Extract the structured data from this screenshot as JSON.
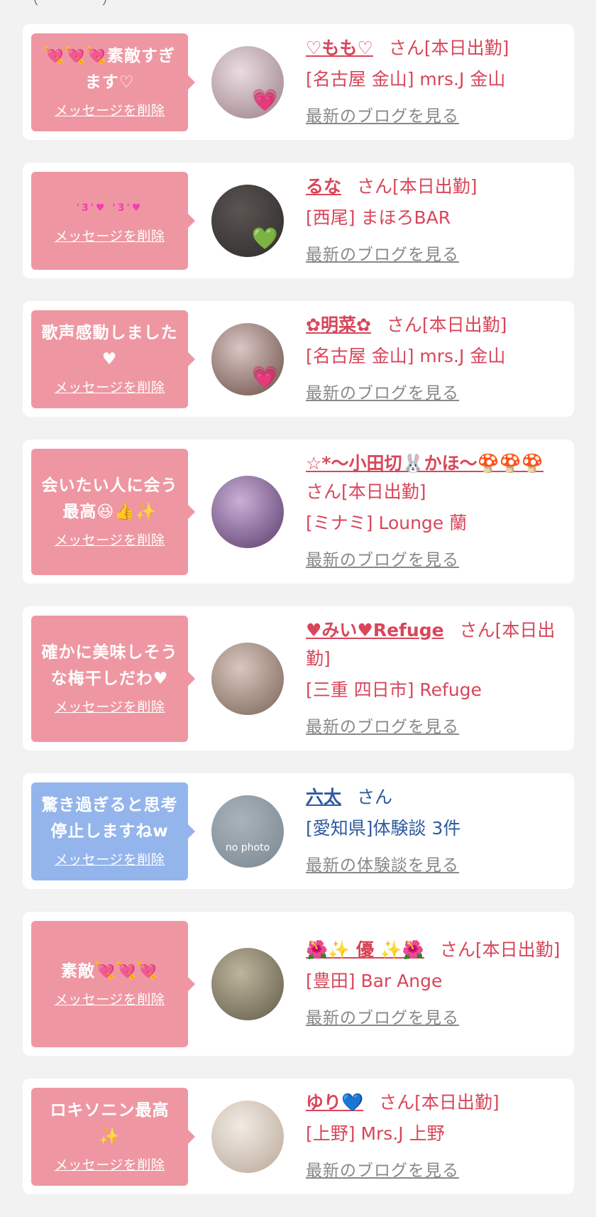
{
  "page": {
    "top_fragment": "（　　　　　）",
    "cards": [
      {
        "message": "💘💘💘素敵すぎます♡",
        "delete_label": "メッセージを削除",
        "name": "♡もも♡",
        "suffix": "さん[本日出勤]",
        "shop": "[名古屋 金山] mrs.J 金山",
        "link": "最新のブログを見る",
        "avatar_colors": [
          "#e9dde2",
          "#9a7e84"
        ],
        "avatar_emoji": "💗",
        "theme": "pink"
      },
      {
        "message": "'3'♥ '3'♥",
        "delete_label": "メッセージを削除",
        "name": "るな",
        "suffix": "さん[本日出勤]",
        "shop": "[西尾] まほろBAR",
        "link": "最新のブログを見る",
        "avatar_colors": [
          "#5b5552",
          "#2e2b2a"
        ],
        "avatar_emoji": "💚",
        "theme": "pink"
      },
      {
        "message": "歌声感動しました♥",
        "delete_label": "メッセージを削除",
        "name": "✿明菜✿",
        "suffix": "さん[本日出勤]",
        "shop": "[名古屋 金山] mrs.J 金山",
        "link": "最新のブログを見る",
        "avatar_colors": [
          "#d9c6c4",
          "#6a4d44"
        ],
        "avatar_emoji": "💗",
        "theme": "pink"
      },
      {
        "message": "会いたい人に会う最高😆👍✨",
        "delete_label": "メッセージを削除",
        "name": "☆*〜小田切🐰かほ〜🍄🍄🍄",
        "suffix": "さん[本日出勤]",
        "shop": "[ミナミ] Lounge 蘭",
        "link": "最新のブログを見る",
        "avatar_colors": [
          "#c9b0d6",
          "#5a3a6a"
        ],
        "avatar_emoji": "",
        "theme": "pink"
      },
      {
        "message": "確かに美味しそうな梅干しだわ♥",
        "delete_label": "メッセージを削除",
        "name": "♥みい♥Refuge",
        "suffix": "さん[本日出勤]",
        "shop": "[三重 四日市] Refuge",
        "link": "最新のブログを見る",
        "avatar_colors": [
          "#d8c7bd",
          "#7a6358"
        ],
        "avatar_emoji": "",
        "theme": "pink"
      },
      {
        "message": "驚き過ぎると思考停止しますねw",
        "delete_label": "メッセージを削除",
        "name": "六太",
        "suffix": "さん",
        "shop": "[愛知県]体験談 3件",
        "link": "最新の体験談を見る",
        "avatar_colors": [
          "#a9b3ba",
          "#7a8791"
        ],
        "avatar_emoji": "",
        "avatar_text": "no photo",
        "theme": "blue"
      },
      {
        "message": "素敵💘💘💘",
        "delete_label": "メッセージを削除",
        "name": "🌺✨ 優 ✨🌺",
        "suffix": "さん[本日出勤]",
        "shop": "[豊田] Bar Ange",
        "link": "最新のブログを見る",
        "avatar_colors": [
          "#bfb59c",
          "#5f5a47"
        ],
        "avatar_emoji": "",
        "theme": "pink"
      },
      {
        "message": "ロキソニン最高✨",
        "delete_label": "メッセージを削除",
        "name": "ゆり💙",
        "suffix": "さん[本日出勤]",
        "shop": "[上野] Mrs.J 上野",
        "link": "最新のブログを見る",
        "avatar_colors": [
          "#f1ebe4",
          "#b9a898"
        ],
        "avatar_emoji": "",
        "theme": "pink"
      }
    ]
  }
}
